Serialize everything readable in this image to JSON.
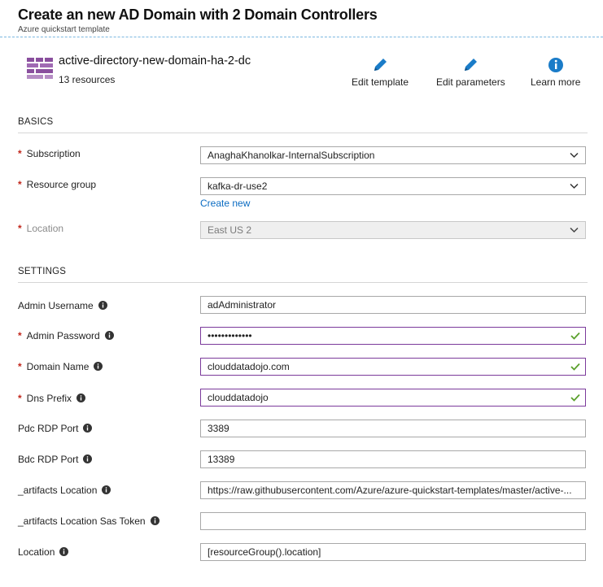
{
  "header": {
    "title": "Create an new AD Domain with 2 Domain Controllers",
    "subtitle": "Azure quickstart template"
  },
  "template": {
    "icon": "template-bricks-icon",
    "name": "active-directory-new-domain-ha-2-dc",
    "resource_count": "13 resources"
  },
  "actions": {
    "edit_template": "Edit template",
    "edit_parameters": "Edit parameters",
    "learn_more": "Learn more"
  },
  "basics": {
    "heading": "BASICS",
    "subscription_label": "Subscription",
    "subscription_value": "AnaghaKhanolkar-InternalSubscription",
    "resource_group_label": "Resource group",
    "resource_group_value": "kafka-dr-use2",
    "create_new_link": "Create new",
    "location_label": "Location",
    "location_value": "East US 2"
  },
  "settings": {
    "heading": "SETTINGS",
    "fields": [
      {
        "label": "Admin Username",
        "value": "adAdministrator"
      },
      {
        "label": "Admin Password",
        "value": "•••••••••••••"
      },
      {
        "label": "Domain Name",
        "value": "clouddatadojo.com"
      },
      {
        "label": "Dns Prefix",
        "value": "clouddatadojo"
      },
      {
        "label": "Pdc RDP Port",
        "value": "3389"
      },
      {
        "label": "Bdc RDP Port",
        "value": "13389"
      },
      {
        "label": "_artifacts Location",
        "value": "https://raw.githubusercontent.com/Azure/azure-quickstart-templates/master/active-..."
      },
      {
        "label": "_artifacts Location Sas Token",
        "value": ""
      },
      {
        "label": "Location",
        "value": "[resourceGroup().location]"
      }
    ]
  },
  "colors": {
    "accent_blue": "#1a7cc8",
    "required_star": "#c1261b",
    "valid_border": "#7b3a9b",
    "valid_check": "#5aa02c",
    "template_icon": "#8a4f9e"
  }
}
